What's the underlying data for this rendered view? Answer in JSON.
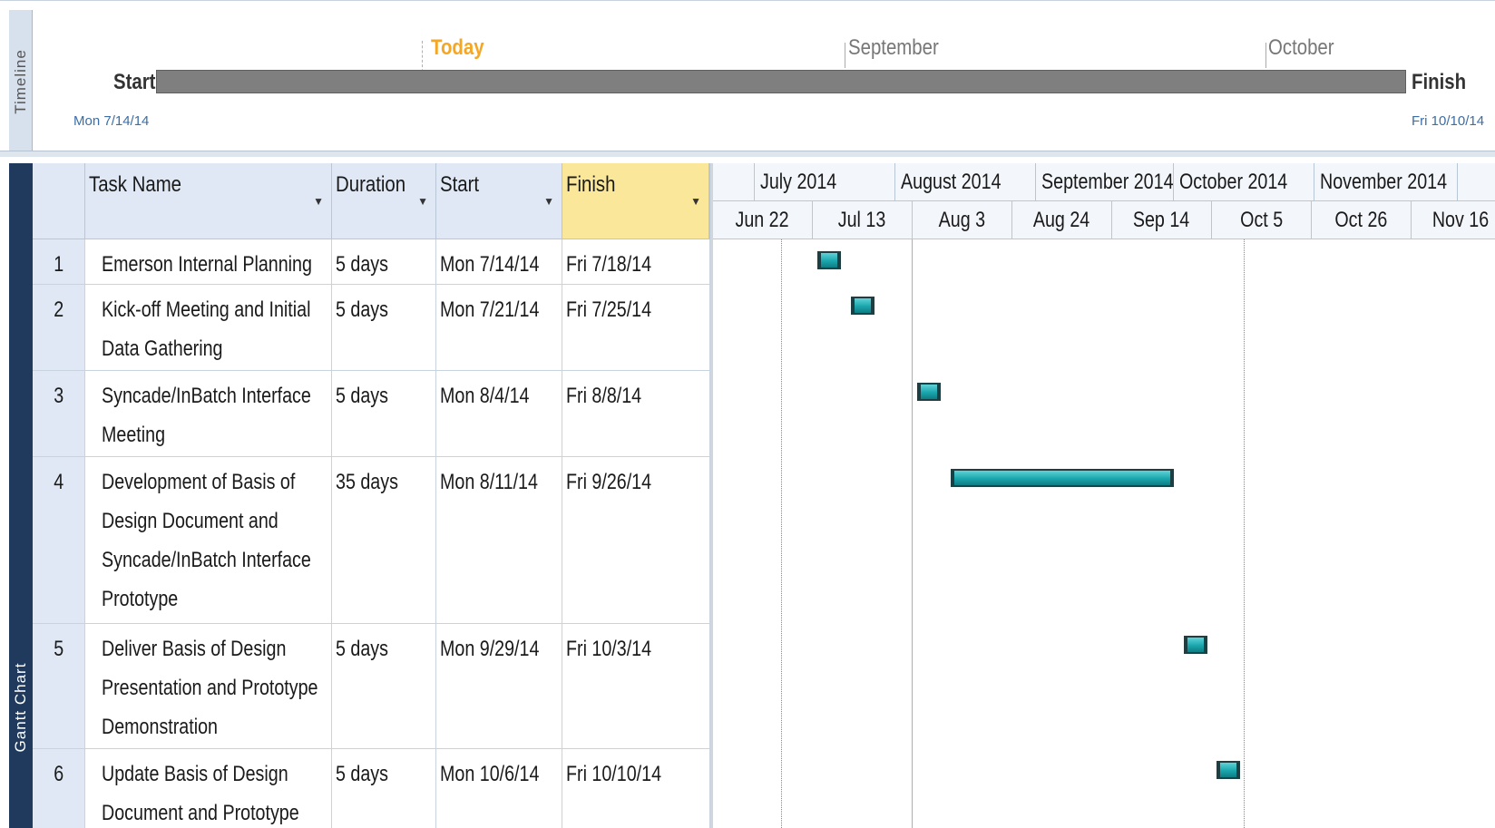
{
  "timeline": {
    "tab_label": "Timeline",
    "start_label": "Start",
    "finish_label": "Finish",
    "start_date": "Mon 7/14/14",
    "finish_date": "Fri 10/10/14",
    "today_label": "Today",
    "markers": [
      "September",
      "October"
    ]
  },
  "view_tab": "Gantt Chart",
  "columns": {
    "task_name": "Task Name",
    "duration": "Duration",
    "start": "Start",
    "finish": "Finish"
  },
  "tasks": [
    {
      "id": "1",
      "name": "Emerson Internal Planning",
      "duration": "5 days",
      "start": "Mon 7/14/14",
      "finish": "Fri 7/18/14"
    },
    {
      "id": "2",
      "name": "Kick-off Meeting and Initial\nData Gathering",
      "duration": "5 days",
      "start": "Mon 7/21/14",
      "finish": "Fri 7/25/14"
    },
    {
      "id": "3",
      "name": "Syncade/InBatch Interface\nMeeting",
      "duration": "5 days",
      "start": "Mon 8/4/14",
      "finish": "Fri 8/8/14"
    },
    {
      "id": "4",
      "name": "Development of Basis of\nDesign Document and\nSyncade/InBatch Interface\nPrototype",
      "duration": "35 days",
      "start": "Mon 8/11/14",
      "finish": "Fri 9/26/14"
    },
    {
      "id": "5",
      "name": "Deliver Basis of Design\nPresentation and Prototype\nDemonstration",
      "duration": "5 days",
      "start": "Mon 9/29/14",
      "finish": "Fri 10/3/14"
    },
    {
      "id": "6",
      "name": "Update Basis of Design\nDocument and Prototype",
      "duration": "5 days",
      "start": "Mon 10/6/14",
      "finish": "Fri 10/10/14"
    }
  ],
  "gantt": {
    "months": [
      "July 2014",
      "August 2014",
      "September 2014",
      "October 2014",
      "November 2014"
    ],
    "weeks": [
      "Jun 22",
      "Jul 13",
      "Aug 3",
      "Aug 24",
      "Sep 14",
      "Oct 5",
      "Oct 26",
      "Nov 16"
    ],
    "bar_color": "#1aa6ad",
    "today_line_color": "#f5a623"
  }
}
